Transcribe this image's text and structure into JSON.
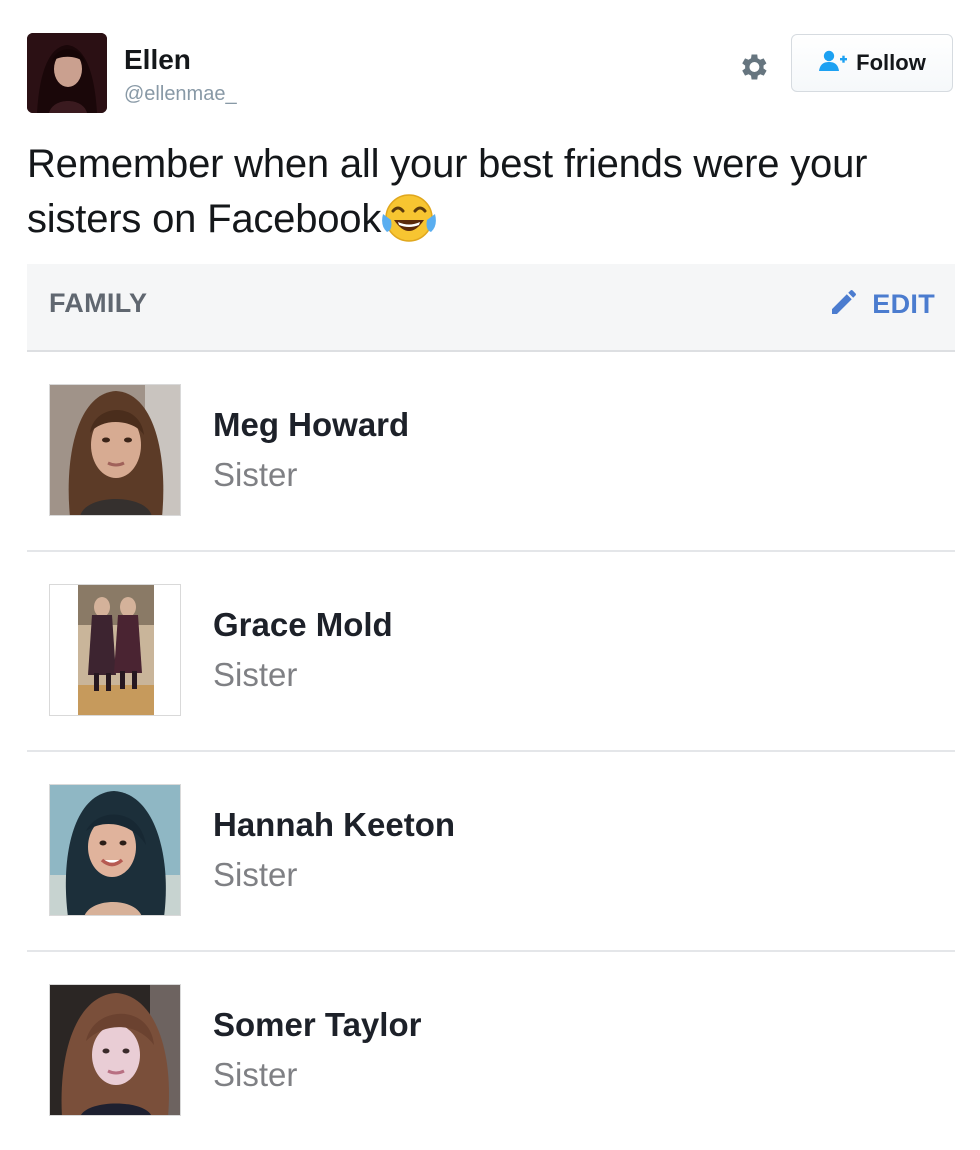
{
  "tweet": {
    "author_name": "Ellen",
    "author_handle": "@ellenmae_",
    "follow_label": "Follow",
    "text": "Remember when all your best friends were your sisters on Facebook"
  },
  "family_card": {
    "title": "FAMILY",
    "edit_label": "EDIT",
    "members": [
      {
        "name": "Meg Howard",
        "relation": "Sister"
      },
      {
        "name": "Grace Mold",
        "relation": "Sister"
      },
      {
        "name": "Hannah Keeton",
        "relation": "Sister"
      },
      {
        "name": "Somer Taylor",
        "relation": "Sister"
      }
    ]
  },
  "icons": {
    "settings": "gear-icon",
    "follow": "add-person-icon",
    "edit": "pencil-icon",
    "emoji": "face-with-tears-of-joy"
  },
  "colors": {
    "twitter_blue": "#1da1f2",
    "facebook_link": "#4b7ccf",
    "card_header_bg": "#f5f6f7"
  }
}
